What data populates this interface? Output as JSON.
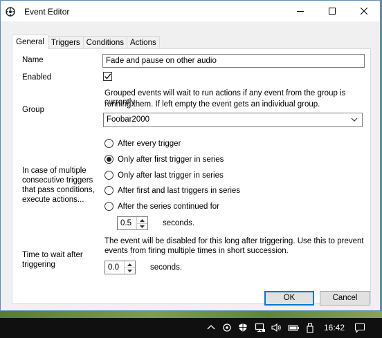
{
  "window": {
    "title": "Event Editor"
  },
  "tabs": [
    "General",
    "Triggers",
    "Conditions",
    "Actions"
  ],
  "general": {
    "name_label": "Name",
    "name_value": "Fade and pause on other audio",
    "enabled_label": "Enabled",
    "enabled_checked": true,
    "group_label": "Group",
    "group_desc_1": "Grouped events will wait to run actions if any event from the group is currently",
    "group_desc_2": "running them. If left empty the event gets an individual group.",
    "group_value": "Foobar2000",
    "mode_label_lines": [
      "In case of multiple",
      "consecutive triggers",
      "that pass conditions,",
      "execute actions..."
    ],
    "mode_options": [
      "After every trigger",
      "Only after first trigger in series",
      "Only after last trigger in series",
      "After first and last triggers in series",
      "After the series continued for"
    ],
    "mode_selected_index": 1,
    "series_seconds_value": "0.5",
    "series_seconds_unit": "seconds.",
    "wait_label_lines": [
      "Time to wait after",
      "triggering"
    ],
    "wait_desc_1": "The event will be disabled for this long after triggering. Use this to prevent",
    "wait_desc_2": "events from firing multiple times in short succession.",
    "wait_seconds_value": "0.0",
    "wait_seconds_unit": "seconds."
  },
  "buttons": {
    "ok": "OK",
    "cancel": "Cancel"
  },
  "taskbar": {
    "time": "16:42"
  }
}
